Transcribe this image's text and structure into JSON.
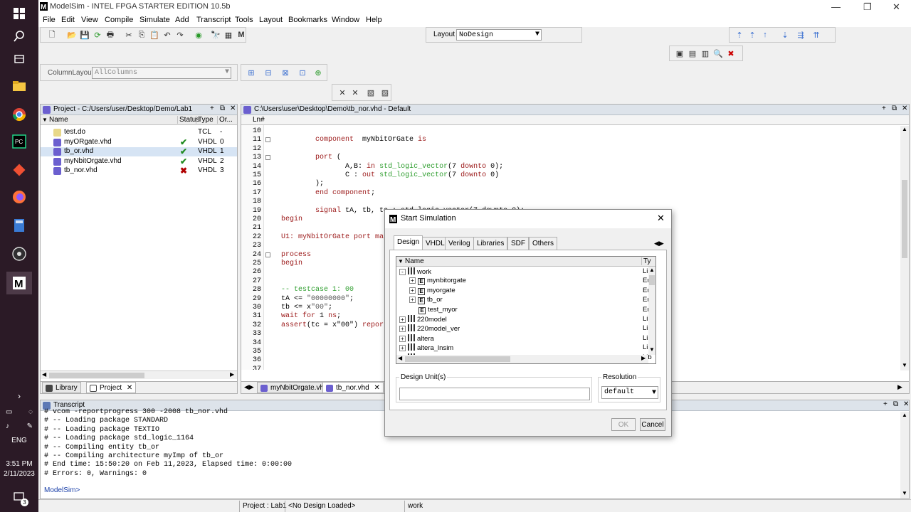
{
  "taskbar": {
    "time": "3:51 PM",
    "date": "2/11/2023",
    "lang": "ENG",
    "notify_count": "3"
  },
  "window": {
    "title": "ModelSim - INTEL FPGA STARTER EDITION 10.5b",
    "menu": [
      "File",
      "Edit",
      "View",
      "Compile",
      "Simulate",
      "Add",
      "Transcript",
      "Tools",
      "Layout",
      "Bookmarks",
      "Window",
      "Help"
    ]
  },
  "toolbar": {
    "layout_label": "Layout",
    "layout_value": "NoDesign",
    "column_layout_label": "ColumnLayout",
    "column_layout_value": "AllColumns"
  },
  "project_pane": {
    "title": "Project - C:/Users/user/Desktop/Demo/Lab1",
    "columns": [
      "Name",
      "Status",
      "Type",
      "Or..."
    ],
    "files": [
      {
        "name": "test.do",
        "status": "?",
        "type": "TCL",
        "order": "-"
      },
      {
        "name": "myORgate.vhd",
        "status": "ok",
        "type": "VHDL",
        "order": "0"
      },
      {
        "name": "tb_or.vhd",
        "status": "ok",
        "type": "VHDL",
        "order": "1"
      },
      {
        "name": "myNbitOrgate.vhd",
        "status": "ok",
        "type": "VHDL",
        "order": "2"
      },
      {
        "name": "tb_nor.vhd",
        "status": "err",
        "type": "VHDL",
        "order": "3"
      }
    ],
    "tabs": [
      "Library",
      "Project"
    ]
  },
  "editor": {
    "title": "C:\\Users\\user\\Desktop\\Demo\\tb_nor.vhd - Default",
    "ln_header": "Ln#",
    "tabs": [
      "myNbitOrgate.vhd",
      "tb_nor.vhd"
    ]
  },
  "dialog": {
    "title": "Start Simulation",
    "tabs": [
      "Design",
      "VHDL",
      "Verilog",
      "Libraries",
      "SDF",
      "Others"
    ],
    "tree_header_name": "Name",
    "tree_header_type": "Ty",
    "tree": [
      {
        "name": "work",
        "kind": "lib",
        "type": "Lib",
        "level": 0,
        "exp": "-"
      },
      {
        "name": "mynbitorgate",
        "kind": "ent",
        "type": "En",
        "level": 1,
        "exp": "+"
      },
      {
        "name": "myorgate",
        "kind": "ent",
        "type": "En",
        "level": 1,
        "exp": "+"
      },
      {
        "name": "tb_or",
        "kind": "ent",
        "type": "En",
        "level": 1,
        "exp": "+"
      },
      {
        "name": "test_myor",
        "kind": "ent",
        "type": "En",
        "level": 1,
        "exp": ""
      },
      {
        "name": "220model",
        "kind": "lib",
        "type": "Lib",
        "level": 0,
        "exp": "+"
      },
      {
        "name": "220model_ver",
        "kind": "lib",
        "type": "Lib",
        "level": 0,
        "exp": "+"
      },
      {
        "name": "altera",
        "kind": "lib",
        "type": "Lib",
        "level": 0,
        "exp": "+"
      },
      {
        "name": "altera_lnsim",
        "kind": "lib",
        "type": "Lib",
        "level": 0,
        "exp": "+"
      },
      {
        "name": "altera_lnsim_ver",
        "kind": "lib",
        "type": "Lib",
        "level": 0,
        "exp": "+"
      }
    ],
    "design_units_label": "Design Unit(s)",
    "design_units_value": "",
    "resolution_label": "Resolution",
    "resolution_value": "default",
    "ok_label": "OK",
    "cancel_label": "Cancel"
  },
  "transcript": {
    "title": "Transcript",
    "lines": [
      "# vcom -reportprogress 300 -2008 tb_nor.vhd",
      "# -- Loading package STANDARD",
      "# -- Loading package TEXTIO",
      "# -- Loading package std_logic_1164",
      "# -- Compiling entity tb_or",
      "# -- Compiling architecture myImp of tb_or",
      "# End time: 15:50:20 on Feb 11,2023, Elapsed time: 0:00:00",
      "# Errors: 0, Warnings: 0"
    ],
    "prompt": "ModelSim>"
  },
  "statusbar": {
    "project": "Project : Lab1",
    "design": "<No Design Loaded>",
    "lib": "work"
  },
  "colors": {
    "vhdl_file": "#6b5fcf",
    "tcl_file": "#e8d88a",
    "ok_check": "#1f8a1f",
    "error_x": "#b00000",
    "keyword": "#9b1818",
    "type_green": "#2f9e2f"
  }
}
